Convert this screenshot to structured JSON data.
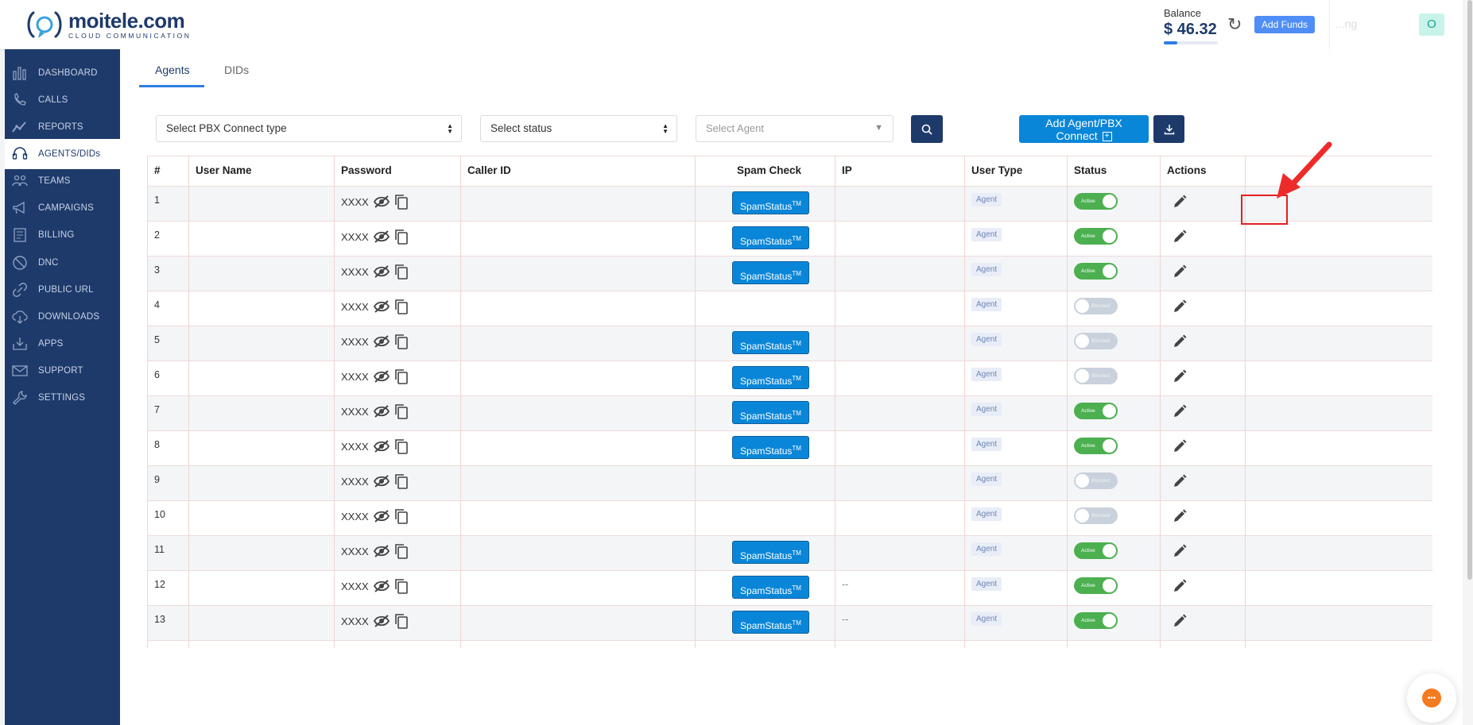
{
  "brand": {
    "name": "moitele.com",
    "tagline": "CLOUD COMMUNICATION"
  },
  "header": {
    "balance_label": "Balance",
    "balance_value": "$ 46.32",
    "balance_progress": 0.25,
    "add_funds_label": "Add Funds",
    "user_text": "...ng",
    "avatar_initial": "O"
  },
  "sidebar": {
    "items": [
      {
        "label": "DASHBOARD",
        "icon": "dashboard-icon"
      },
      {
        "label": "CALLS",
        "icon": "calls-icon"
      },
      {
        "label": "REPORTS",
        "icon": "reports-icon"
      },
      {
        "label": "AGENTS/DIDs",
        "icon": "headset-icon",
        "active": true
      },
      {
        "label": "TEAMS",
        "icon": "teams-icon"
      },
      {
        "label": "CAMPAIGNS",
        "icon": "megaphone-icon"
      },
      {
        "label": "BILLING",
        "icon": "billing-icon"
      },
      {
        "label": "DNC",
        "icon": "dnc-icon"
      },
      {
        "label": "PUBLIC URL",
        "icon": "link-icon"
      },
      {
        "label": "DOWNLOADS",
        "icon": "cloud-download-icon"
      },
      {
        "label": "APPS",
        "icon": "apps-icon"
      },
      {
        "label": "SUPPORT",
        "icon": "mail-icon"
      },
      {
        "label": "SETTINGS",
        "icon": "wrench-icon"
      }
    ]
  },
  "tabs": [
    {
      "label": "Agents",
      "active": true
    },
    {
      "label": "DIDs",
      "active": false
    }
  ],
  "filters": {
    "pbx_type": "Select PBX Connect type",
    "status": "Select status",
    "agent_placeholder": "Select Agent"
  },
  "add_agent_label": "Add Agent/PBX Connect",
  "table": {
    "headers": [
      "#",
      "User Name",
      "Password",
      "Caller ID",
      "Spam Check",
      "IP",
      "User Type",
      "Status",
      "Actions"
    ],
    "password_mask": "XXXX",
    "spam_label": "SpamStatus",
    "spam_tm": "TM",
    "rows": [
      {
        "num": "1",
        "spam": true,
        "ip": "",
        "type": "Agent",
        "status": "Active",
        "active": true
      },
      {
        "num": "2",
        "spam": true,
        "ip": "",
        "type": "Agent",
        "status": "Active",
        "active": true
      },
      {
        "num": "3",
        "spam": true,
        "ip": "",
        "type": "Agent",
        "status": "Active",
        "active": true
      },
      {
        "num": "4",
        "spam": false,
        "ip": "",
        "type": "Agent",
        "status": "Blocked",
        "active": false
      },
      {
        "num": "5",
        "spam": true,
        "ip": "",
        "type": "Agent",
        "status": "Blocked",
        "active": false
      },
      {
        "num": "6",
        "spam": true,
        "ip": "",
        "type": "Agent",
        "status": "Blocked",
        "active": false
      },
      {
        "num": "7",
        "spam": true,
        "ip": "",
        "type": "Agent",
        "status": "Active",
        "active": true
      },
      {
        "num": "8",
        "spam": true,
        "ip": "",
        "type": "Agent",
        "status": "Active",
        "active": true
      },
      {
        "num": "9",
        "spam": false,
        "ip": "",
        "type": "Agent",
        "status": "Blocked",
        "active": false
      },
      {
        "num": "10",
        "spam": false,
        "ip": "",
        "type": "Agent",
        "status": "Blocked",
        "active": false
      },
      {
        "num": "11",
        "spam": true,
        "ip": "",
        "type": "Agent",
        "status": "Active",
        "active": true
      },
      {
        "num": "12",
        "spam": true,
        "ip": "--",
        "type": "Agent",
        "status": "Active",
        "active": true
      },
      {
        "num": "13",
        "spam": true,
        "ip": "--",
        "type": "Agent",
        "status": "Active",
        "active": true
      }
    ]
  },
  "colors": {
    "primary": "#1e3a6b",
    "accent": "#0a86d8",
    "active": "#4caf50",
    "blocked": "#c9d1dc",
    "annotation": "#e02020"
  }
}
